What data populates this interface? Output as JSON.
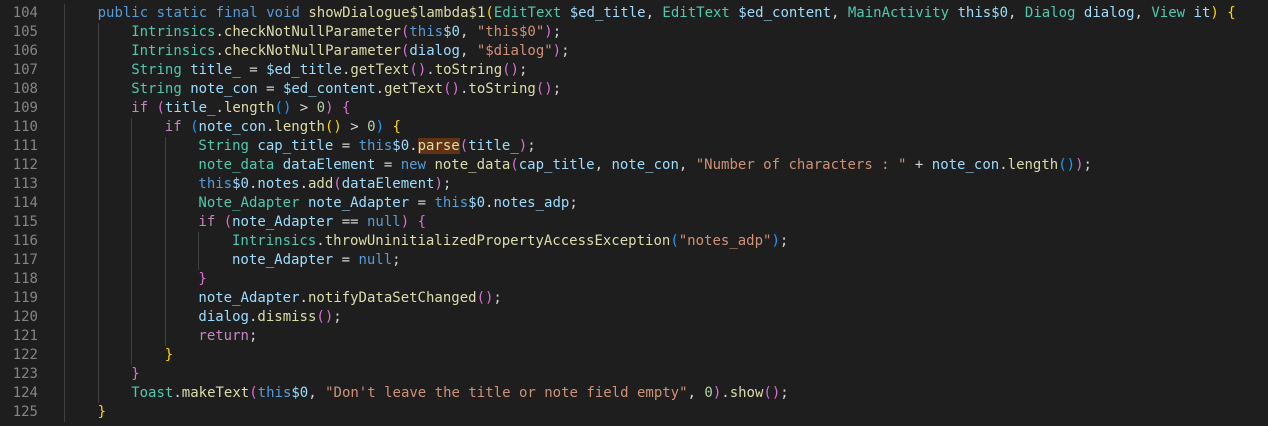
{
  "editor": {
    "lines": [
      {
        "num": "104",
        "indent": 1,
        "tokens": [
          {
            "c": "k",
            "t": "public"
          },
          {
            "c": "",
            "t": " "
          },
          {
            "c": "k",
            "t": "static"
          },
          {
            "c": "",
            "t": " "
          },
          {
            "c": "k",
            "t": "final"
          },
          {
            "c": "",
            "t": " "
          },
          {
            "c": "k",
            "t": "void"
          },
          {
            "c": "",
            "t": " "
          },
          {
            "c": "f",
            "t": "showDialogue$lambda$1"
          },
          {
            "c": "p1",
            "t": "("
          },
          {
            "c": "t",
            "t": "EditText"
          },
          {
            "c": "",
            "t": " "
          },
          {
            "c": "v",
            "t": "$ed_title"
          },
          {
            "c": "",
            "t": ", "
          },
          {
            "c": "t",
            "t": "EditText"
          },
          {
            "c": "",
            "t": " "
          },
          {
            "c": "v",
            "t": "$ed_content"
          },
          {
            "c": "",
            "t": ", "
          },
          {
            "c": "t",
            "t": "MainActivity"
          },
          {
            "c": "",
            "t": " "
          },
          {
            "c": "v",
            "t": "this$0"
          },
          {
            "c": "",
            "t": ", "
          },
          {
            "c": "t",
            "t": "Dialog"
          },
          {
            "c": "",
            "t": " "
          },
          {
            "c": "v",
            "t": "dialog"
          },
          {
            "c": "",
            "t": ", "
          },
          {
            "c": "t",
            "t": "View"
          },
          {
            "c": "",
            "t": " "
          },
          {
            "c": "v",
            "t": "it"
          },
          {
            "c": "p1",
            "t": ")"
          },
          {
            "c": "",
            "t": " "
          },
          {
            "c": "p1",
            "t": "{"
          }
        ]
      },
      {
        "num": "105",
        "indent": 2,
        "tokens": [
          {
            "c": "t",
            "t": "Intrinsics"
          },
          {
            "c": "",
            "t": "."
          },
          {
            "c": "f",
            "t": "checkNotNullParameter"
          },
          {
            "c": "p2",
            "t": "("
          },
          {
            "c": "k",
            "t": "this"
          },
          {
            "c": "v",
            "t": "$0"
          },
          {
            "c": "",
            "t": ", "
          },
          {
            "c": "s",
            "t": "\"this$0\""
          },
          {
            "c": "p2",
            "t": ")"
          },
          {
            "c": "",
            "t": ";"
          }
        ]
      },
      {
        "num": "106",
        "indent": 2,
        "tokens": [
          {
            "c": "t",
            "t": "Intrinsics"
          },
          {
            "c": "",
            "t": "."
          },
          {
            "c": "f",
            "t": "checkNotNullParameter"
          },
          {
            "c": "p2",
            "t": "("
          },
          {
            "c": "v",
            "t": "dialog"
          },
          {
            "c": "",
            "t": ", "
          },
          {
            "c": "s",
            "t": "\"$dialog\""
          },
          {
            "c": "p2",
            "t": ")"
          },
          {
            "c": "",
            "t": ";"
          }
        ]
      },
      {
        "num": "107",
        "indent": 2,
        "tokens": [
          {
            "c": "t",
            "t": "String"
          },
          {
            "c": "",
            "t": " "
          },
          {
            "c": "v",
            "t": "title_"
          },
          {
            "c": "",
            "t": " = "
          },
          {
            "c": "v",
            "t": "$ed_title"
          },
          {
            "c": "",
            "t": "."
          },
          {
            "c": "f",
            "t": "getText"
          },
          {
            "c": "p2",
            "t": "()"
          },
          {
            "c": "",
            "t": "."
          },
          {
            "c": "f",
            "t": "toString"
          },
          {
            "c": "p2",
            "t": "()"
          },
          {
            "c": "",
            "t": ";"
          }
        ]
      },
      {
        "num": "108",
        "indent": 2,
        "tokens": [
          {
            "c": "t",
            "t": "String"
          },
          {
            "c": "",
            "t": " "
          },
          {
            "c": "v",
            "t": "note_con"
          },
          {
            "c": "",
            "t": " = "
          },
          {
            "c": "v",
            "t": "$ed_content"
          },
          {
            "c": "",
            "t": "."
          },
          {
            "c": "f",
            "t": "getText"
          },
          {
            "c": "p2",
            "t": "()"
          },
          {
            "c": "",
            "t": "."
          },
          {
            "c": "f",
            "t": "toString"
          },
          {
            "c": "p2",
            "t": "()"
          },
          {
            "c": "",
            "t": ";"
          }
        ]
      },
      {
        "num": "109",
        "indent": 2,
        "tokens": [
          {
            "c": "c",
            "t": "if"
          },
          {
            "c": "",
            "t": " "
          },
          {
            "c": "p2",
            "t": "("
          },
          {
            "c": "v",
            "t": "title_"
          },
          {
            "c": "",
            "t": "."
          },
          {
            "c": "f",
            "t": "length"
          },
          {
            "c": "p3",
            "t": "()"
          },
          {
            "c": "",
            "t": " > "
          },
          {
            "c": "n",
            "t": "0"
          },
          {
            "c": "p2",
            "t": ")"
          },
          {
            "c": "",
            "t": " "
          },
          {
            "c": "p2",
            "t": "{"
          }
        ]
      },
      {
        "num": "110",
        "indent": 3,
        "tokens": [
          {
            "c": "c",
            "t": "if"
          },
          {
            "c": "",
            "t": " "
          },
          {
            "c": "p3",
            "t": "("
          },
          {
            "c": "v",
            "t": "note_con"
          },
          {
            "c": "",
            "t": "."
          },
          {
            "c": "f",
            "t": "length"
          },
          {
            "c": "p1",
            "t": "()"
          },
          {
            "c": "",
            "t": " > "
          },
          {
            "c": "n",
            "t": "0"
          },
          {
            "c": "p3",
            "t": ")"
          },
          {
            "c": "",
            "t": " "
          },
          {
            "c": "p1",
            "t": "{"
          }
        ]
      },
      {
        "num": "111",
        "indent": 4,
        "tokens": [
          {
            "c": "t",
            "t": "String"
          },
          {
            "c": "",
            "t": " "
          },
          {
            "c": "v",
            "t": "cap_title"
          },
          {
            "c": "",
            "t": " = "
          },
          {
            "c": "k",
            "t": "this"
          },
          {
            "c": "v",
            "t": "$0"
          },
          {
            "c": "",
            "t": "."
          },
          {
            "c": "f hl",
            "t": "parse"
          },
          {
            "c": "p2",
            "t": "("
          },
          {
            "c": "v",
            "t": "title_"
          },
          {
            "c": "p2",
            "t": ")"
          },
          {
            "c": "",
            "t": ";"
          }
        ]
      },
      {
        "num": "112",
        "indent": 4,
        "tokens": [
          {
            "c": "t",
            "t": "note_data"
          },
          {
            "c": "",
            "t": " "
          },
          {
            "c": "v",
            "t": "dataElement"
          },
          {
            "c": "",
            "t": " = "
          },
          {
            "c": "k",
            "t": "new"
          },
          {
            "c": "",
            "t": " "
          },
          {
            "c": "f",
            "t": "note_data"
          },
          {
            "c": "p2",
            "t": "("
          },
          {
            "c": "v",
            "t": "cap_title"
          },
          {
            "c": "",
            "t": ", "
          },
          {
            "c": "v",
            "t": "note_con"
          },
          {
            "c": "",
            "t": ", "
          },
          {
            "c": "s",
            "t": "\"Number of characters : \""
          },
          {
            "c": "",
            "t": " + "
          },
          {
            "c": "v",
            "t": "note_con"
          },
          {
            "c": "",
            "t": "."
          },
          {
            "c": "f",
            "t": "length"
          },
          {
            "c": "p3",
            "t": "()"
          },
          {
            "c": "p2",
            "t": ")"
          },
          {
            "c": "",
            "t": ";"
          }
        ]
      },
      {
        "num": "113",
        "indent": 4,
        "tokens": [
          {
            "c": "k",
            "t": "this"
          },
          {
            "c": "v",
            "t": "$0"
          },
          {
            "c": "",
            "t": "."
          },
          {
            "c": "v",
            "t": "notes"
          },
          {
            "c": "",
            "t": "."
          },
          {
            "c": "f",
            "t": "add"
          },
          {
            "c": "p2",
            "t": "("
          },
          {
            "c": "v",
            "t": "dataElement"
          },
          {
            "c": "p2",
            "t": ")"
          },
          {
            "c": "",
            "t": ";"
          }
        ]
      },
      {
        "num": "114",
        "indent": 4,
        "tokens": [
          {
            "c": "t",
            "t": "Note_Adapter"
          },
          {
            "c": "",
            "t": " "
          },
          {
            "c": "v",
            "t": "note_Adapter"
          },
          {
            "c": "",
            "t": " = "
          },
          {
            "c": "k",
            "t": "this"
          },
          {
            "c": "v",
            "t": "$0"
          },
          {
            "c": "",
            "t": "."
          },
          {
            "c": "v",
            "t": "notes_adp"
          },
          {
            "c": "",
            "t": ";"
          }
        ]
      },
      {
        "num": "115",
        "indent": 4,
        "tokens": [
          {
            "c": "c",
            "t": "if"
          },
          {
            "c": "",
            "t": " "
          },
          {
            "c": "p2",
            "t": "("
          },
          {
            "c": "v",
            "t": "note_Adapter"
          },
          {
            "c": "",
            "t": " == "
          },
          {
            "c": "k",
            "t": "null"
          },
          {
            "c": "p2",
            "t": ")"
          },
          {
            "c": "",
            "t": " "
          },
          {
            "c": "p2",
            "t": "{"
          }
        ]
      },
      {
        "num": "116",
        "indent": 5,
        "tokens": [
          {
            "c": "t",
            "t": "Intrinsics"
          },
          {
            "c": "",
            "t": "."
          },
          {
            "c": "f",
            "t": "throwUninitializedPropertyAccessException"
          },
          {
            "c": "p3",
            "t": "("
          },
          {
            "c": "s",
            "t": "\"notes_adp\""
          },
          {
            "c": "p3",
            "t": ")"
          },
          {
            "c": "",
            "t": ";"
          }
        ]
      },
      {
        "num": "117",
        "indent": 5,
        "tokens": [
          {
            "c": "v",
            "t": "note_Adapter"
          },
          {
            "c": "",
            "t": " = "
          },
          {
            "c": "k",
            "t": "null"
          },
          {
            "c": "",
            "t": ";"
          }
        ]
      },
      {
        "num": "118",
        "indent": 4,
        "tokens": [
          {
            "c": "p2",
            "t": "}"
          }
        ]
      },
      {
        "num": "119",
        "indent": 4,
        "tokens": [
          {
            "c": "v",
            "t": "note_Adapter"
          },
          {
            "c": "",
            "t": "."
          },
          {
            "c": "f",
            "t": "notifyDataSetChanged"
          },
          {
            "c": "p2",
            "t": "()"
          },
          {
            "c": "",
            "t": ";"
          }
        ]
      },
      {
        "num": "120",
        "indent": 4,
        "tokens": [
          {
            "c": "v",
            "t": "dialog"
          },
          {
            "c": "",
            "t": "."
          },
          {
            "c": "f",
            "t": "dismiss"
          },
          {
            "c": "p2",
            "t": "()"
          },
          {
            "c": "",
            "t": ";"
          }
        ]
      },
      {
        "num": "121",
        "indent": 4,
        "tokens": [
          {
            "c": "c",
            "t": "return"
          },
          {
            "c": "",
            "t": ";"
          }
        ]
      },
      {
        "num": "122",
        "indent": 3,
        "tokens": [
          {
            "c": "p1",
            "t": "}"
          }
        ]
      },
      {
        "num": "123",
        "indent": 2,
        "tokens": [
          {
            "c": "p2",
            "t": "}"
          }
        ]
      },
      {
        "num": "124",
        "indent": 2,
        "tokens": [
          {
            "c": "t",
            "t": "Toast"
          },
          {
            "c": "",
            "t": "."
          },
          {
            "c": "f",
            "t": "makeText"
          },
          {
            "c": "p2",
            "t": "("
          },
          {
            "c": "k",
            "t": "this"
          },
          {
            "c": "v",
            "t": "$0"
          },
          {
            "c": "",
            "t": ", "
          },
          {
            "c": "s",
            "t": "\"Don't leave the title or note field empty\""
          },
          {
            "c": "",
            "t": ", "
          },
          {
            "c": "n",
            "t": "0"
          },
          {
            "c": "p2",
            "t": ")"
          },
          {
            "c": "",
            "t": "."
          },
          {
            "c": "f",
            "t": "show"
          },
          {
            "c": "p2",
            "t": "()"
          },
          {
            "c": "",
            "t": ";"
          }
        ]
      },
      {
        "num": "125",
        "indent": 1,
        "tokens": [
          {
            "c": "p1",
            "t": "}"
          }
        ]
      }
    ]
  }
}
